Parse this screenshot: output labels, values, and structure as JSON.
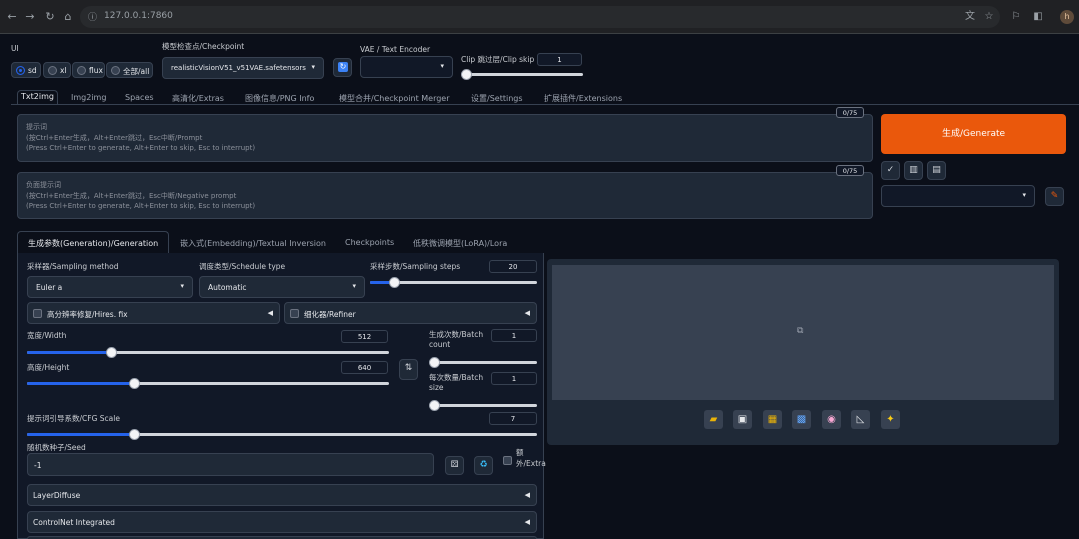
{
  "browser": {
    "url": "127.0.0.1:7860",
    "avatar_letter": "h"
  },
  "ui_mode": {
    "label": "UI",
    "options": [
      "sd",
      "xl",
      "flux",
      "全部/all"
    ],
    "selected": "sd"
  },
  "checkpoint": {
    "label": "模型检查点/Checkpoint",
    "value": "realisticVisionV51_v51VAE.safetensors"
  },
  "vae": {
    "label": "VAE / Text Encoder",
    "value": ""
  },
  "clip_skip": {
    "label": "Clip 跳过层/Clip skip",
    "value": "1",
    "level": 0.0
  },
  "tabs": [
    "Txt2img",
    "Img2img",
    "Spaces",
    "高清化/Extras",
    "图像信息/PNG Info",
    "模型合并/Checkpoint Merger",
    "设置/Settings",
    "扩展插件/Extensions"
  ],
  "prompt": {
    "counter": "0/75",
    "line1": "提示词",
    "line2": "(按Ctrl+Enter生成，Alt+Enter跳过，Esc中断/Prompt",
    "line3": "(Press Ctrl+Enter to generate, Alt+Enter to skip, Esc to interrupt)"
  },
  "negative": {
    "counter": "0/75",
    "line1": "负面提示词",
    "line2": "(按Ctrl+Enter生成，Alt+Enter跳过，Esc中断/Negative prompt",
    "line3": "(Press Ctrl+Enter to generate, Alt+Enter to skip, Esc to interrupt)"
  },
  "generate_label": "生成/Generate",
  "tool_icons": [
    "check-icon",
    "trash-icon",
    "clipboard-icon"
  ],
  "style_select": {
    "value": ""
  },
  "subtabs": [
    "生成参数(Generation)/Generation",
    "嵌入式(Embedding)/Textual Inversion",
    "Checkpoints",
    "低秩微调模型(LoRA)/Lora"
  ],
  "sampling_method": {
    "label": "采样器/Sampling method",
    "value": "Euler a"
  },
  "schedule_type": {
    "label": "调度类型/Schedule type",
    "value": "Automatic"
  },
  "sampling_steps": {
    "label": "采样步数/Sampling steps",
    "value": "20",
    "level": 0.13
  },
  "hires_fix": {
    "label": "高分辨率修复/Hires. fix",
    "checked": false
  },
  "refiner": {
    "label": "细化器/Refiner",
    "checked": false
  },
  "width": {
    "label": "宽度/Width",
    "value": "512",
    "level": 0.23
  },
  "height": {
    "label": "高度/Height",
    "value": "640",
    "level": 0.27
  },
  "batch_count": {
    "label": "生成次数/Batch count",
    "value": "1",
    "level": 0.0
  },
  "batch_size": {
    "label": "每次数量/Batch size",
    "value": "1",
    "level": 0.0
  },
  "cfg_scale": {
    "label": "提示词引导系数/CFG Scale",
    "value": "7",
    "level": 0.2
  },
  "seed": {
    "label": "随机数种子/Seed",
    "value": "-1",
    "extra_label": "额外/Extra"
  },
  "accordions": [
    "LayerDiffuse",
    "ControlNet Integrated"
  ],
  "colors": {
    "accent": "#2563eb",
    "generate": "#ea580c",
    "background": "#0b0f19",
    "panel": "#1f2937"
  },
  "output_tools": [
    "folder-icon",
    "save-icon",
    "zip-icon",
    "image-icon",
    "palette-icon",
    "ruler-icon",
    "sparkle-icon"
  ]
}
